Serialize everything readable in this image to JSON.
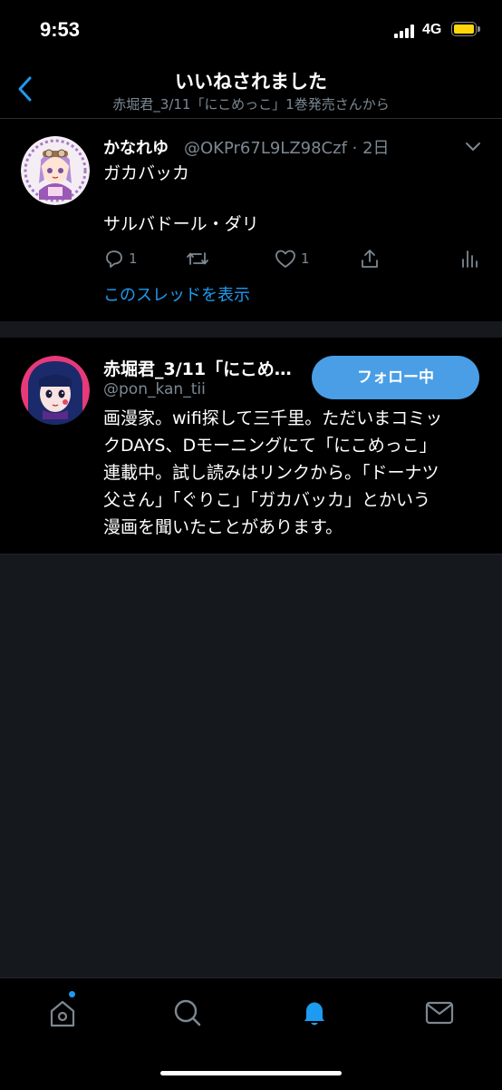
{
  "status_bar": {
    "time": "9:53",
    "network": "4G",
    "battery_color": "#ffd60a"
  },
  "header": {
    "back_icon": "chevron-left-icon",
    "title": "いいねされました",
    "subtitle": "赤堀君_3/11「にこめっこ」1巻発売さんから"
  },
  "tweet": {
    "author_name": "かなれゆ",
    "handle_time": "@OKPr67L9LZ98Czf · 2日",
    "text_lines": [
      "ガカバッカ",
      "",
      "サルバドール・ダリ"
    ],
    "actions": {
      "reply_count": "1",
      "retweet_count": "",
      "like_count": "1"
    },
    "show_thread": "このスレッドを表示"
  },
  "user_card": {
    "name": "赤堀君_3/11「にこめ…",
    "handle": "@pon_kan_tii",
    "follow_label": "フォロー中",
    "bio_lines": [
      "画漫家。wifi探して三千里。ただいまコミッ",
      "クDAYS、Dモーニングにて「にこめっこ」",
      "連載中。試し読みはリンクから。「ドーナツ",
      "父さん」「ぐりこ」「ガカバッカ」とかいう",
      "漫画を聞いたことがあります。"
    ]
  },
  "tab_bar": {
    "tabs": [
      "home-icon",
      "search-icon",
      "notifications-icon",
      "messages-icon"
    ],
    "active": "notifications-icon",
    "accent": "#1d9bf0"
  }
}
